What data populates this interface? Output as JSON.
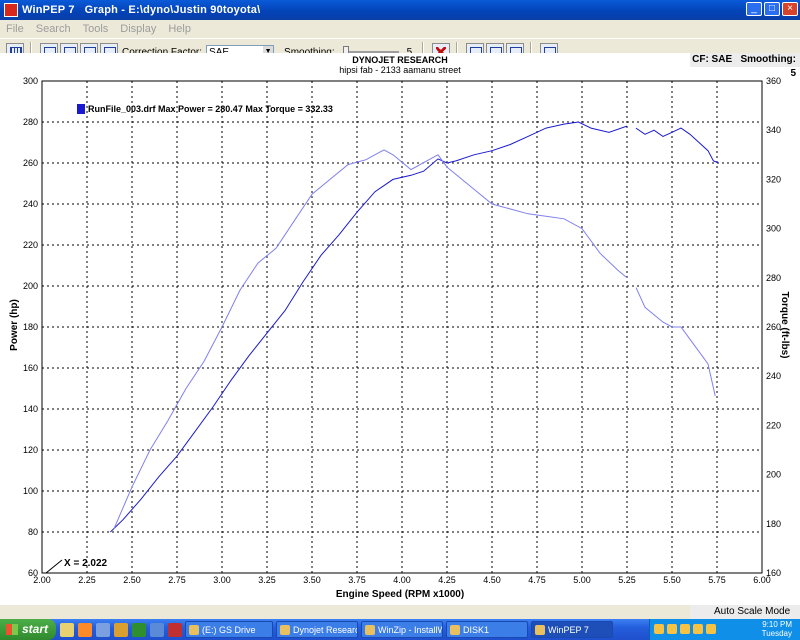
{
  "window": {
    "app": "WinPEP 7",
    "title": "Graph - E:\\dyno\\Justin 90toyota\\"
  },
  "menu": [
    "File",
    "Search",
    "Tools",
    "Display",
    "Help"
  ],
  "toolbar": {
    "correction_label": "Correction Factor:",
    "correction_value": "SAE",
    "smoothing_label": "Smoothing:",
    "smoothing_value": "5"
  },
  "status": {
    "cf_label": "CF: SAE",
    "smoothing_label": "Smoothing: 5",
    "auto_scale": "Auto Scale Mode"
  },
  "chart_data": {
    "type": "line",
    "title": "DYNOJET RESEARCH",
    "subtitle": "hipsi fab  - 2133 aamanu street",
    "xlabel": "Engine Speed (RPM x1000)",
    "ylabel": "Power (hp)",
    "y2label": "Torque (ft-lbs)",
    "xlim": [
      2.0,
      6.0
    ],
    "ylim": [
      60,
      300
    ],
    "y2lim": [
      160,
      360
    ],
    "xticks": [
      "2.00",
      "2.25",
      "2.50",
      "2.75",
      "3.00",
      "3.25",
      "3.50",
      "3.75",
      "4.00",
      "4.25",
      "4.50",
      "4.75",
      "5.00",
      "5.25",
      "5.50",
      "5.75",
      "6.00"
    ],
    "yticks": [
      "60",
      "80",
      "100",
      "120",
      "140",
      "160",
      "180",
      "200",
      "220",
      "240",
      "260",
      "280",
      "300"
    ],
    "y2ticks": [
      "160",
      "180",
      "200",
      "220",
      "240",
      "260",
      "280",
      "300",
      "320",
      "340",
      "360"
    ],
    "grid": true,
    "legend": "RunFile_003.drf Max Power = 280.47 Max Torque = 332.33",
    "cursor_label": "X = 2.022",
    "series": [
      {
        "name": "Power",
        "axis": "left",
        "color": "#1a1ad0",
        "x": [
          2.38,
          2.45,
          2.55,
          2.65,
          2.75,
          2.85,
          2.95,
          3.05,
          3.15,
          3.25,
          3.35,
          3.45,
          3.55,
          3.65,
          3.75,
          3.85,
          3.95,
          4.05,
          4.12,
          4.2,
          4.25,
          4.3,
          4.4,
          4.5,
          4.6,
          4.7,
          4.8,
          4.9,
          4.98,
          5.05,
          5.15,
          5.25
        ],
        "values": [
          80,
          86,
          96,
          107,
          117,
          129,
          141,
          154,
          166,
          177,
          188,
          202,
          215,
          225,
          236,
          246,
          252,
          254,
          256,
          262,
          260,
          261,
          264,
          266,
          269,
          273,
          277,
          279,
          280,
          277,
          275,
          278
        ]
      },
      {
        "name": "Power (cont.)",
        "axis": "left",
        "color": "#1a1ad0",
        "x": [
          5.3,
          5.35,
          5.4,
          5.45,
          5.5,
          5.55,
          5.6,
          5.65,
          5.7,
          5.73,
          5.76
        ],
        "values": [
          277,
          274,
          276,
          273,
          275,
          277,
          274,
          270,
          266,
          261,
          260
        ]
      },
      {
        "name": "Torque",
        "axis": "right",
        "color": "#8080f0",
        "x": [
          2.4,
          2.5,
          2.6,
          2.7,
          2.8,
          2.9,
          3.0,
          3.1,
          3.2,
          3.3,
          3.4,
          3.5,
          3.6,
          3.7,
          3.8,
          3.9,
          3.95,
          4.05,
          4.15,
          4.2,
          4.25,
          4.3,
          4.4,
          4.5,
          4.6,
          4.7,
          4.8,
          4.9,
          5.0,
          5.1,
          5.2,
          5.25
        ],
        "values": [
          178,
          195,
          210,
          222,
          235,
          246,
          260,
          275,
          286,
          292,
          303,
          314,
          320,
          326,
          328,
          332,
          330,
          324,
          328,
          330,
          325,
          322,
          316,
          310,
          308,
          306,
          305,
          304,
          300,
          290,
          283,
          280
        ]
      },
      {
        "name": "Torque (cont.)",
        "axis": "right",
        "color": "#8080f0",
        "x": [
          5.3,
          5.35,
          5.4,
          5.45,
          5.5,
          5.55,
          5.6,
          5.65,
          5.7,
          5.74
        ],
        "values": [
          276,
          268,
          265,
          262,
          260,
          260,
          255,
          250,
          245,
          232
        ]
      }
    ]
  }
}
